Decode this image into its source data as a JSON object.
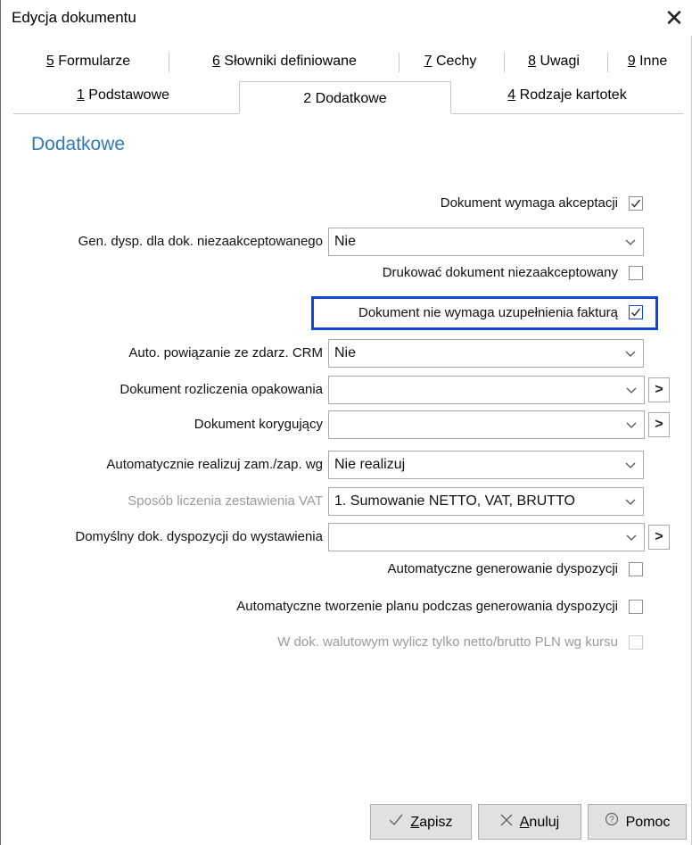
{
  "window": {
    "title": "Edycja dokumentu",
    "close_glyph": "✕"
  },
  "tabs": {
    "row1": [
      {
        "key": "5",
        "label": " Formularze"
      },
      {
        "key": "6",
        "label": " Słowniki definiowane"
      },
      {
        "key": "7",
        "label": " Cechy"
      },
      {
        "key": "8",
        "label": " Uwagi"
      },
      {
        "key": "9",
        "label": " Inne"
      }
    ],
    "row2": [
      {
        "key": "1",
        "label": " Podstawowe"
      },
      {
        "key": "2",
        "label": " Dodatkowe",
        "active": true
      },
      {
        "key": "4",
        "label": " Rodzaje kartotek"
      }
    ]
  },
  "section_title": "Dodatkowe",
  "fields": {
    "akceptacja": {
      "label": "Dokument wymaga akceptacji",
      "checked": true
    },
    "gen_dysp": {
      "label": "Gen. dysp. dla dok. niezaakceptowanego",
      "value": "Nie"
    },
    "drukowac": {
      "label": "Drukować dokument niezaakceptowany",
      "checked": false
    },
    "uzupelnienie": {
      "label": "Dokument nie wymaga uzupełnienia fakturą",
      "checked": true
    },
    "crm": {
      "label": "Auto. powiązanie ze zdarz. CRM",
      "value": "Nie"
    },
    "opakowania": {
      "label": "Dokument rozliczenia opakowania",
      "value": ""
    },
    "korygujacy": {
      "label": "Dokument korygujący",
      "value": ""
    },
    "realizuj": {
      "label": "Automatycznie realizuj zam./zap. wg",
      "value": "Nie realizuj"
    },
    "vat": {
      "label": "Sposób liczenia zestawienia VAT",
      "value": "1. Sumowanie NETTO, VAT, BRUTTO"
    },
    "dyspozycja": {
      "label": "Domyślny dok. dyspozycji do wystawienia",
      "value": ""
    },
    "auto_gen": {
      "label": "Automatyczne generowanie dyspozycji",
      "checked": false
    },
    "auto_plan": {
      "label": "Automatyczne tworzenie planu podczas generowania dyspozycji",
      "checked": false
    },
    "walutowy": {
      "label": "W dok. walutowym wylicz tylko netto/brutto PLN wg kursu",
      "checked": false
    }
  },
  "arrow_glyph": ">",
  "buttons": {
    "save": {
      "key": "Z",
      "rest": "apisz",
      "icon": "check-icon"
    },
    "cancel": {
      "key": "A",
      "rest": "nuluj",
      "icon": "x-icon"
    },
    "help": {
      "label": "Pomoc",
      "icon": "help-circle-icon"
    }
  },
  "colors": {
    "accent_title": "#2e7ab8",
    "highlight": "#1247d6"
  }
}
